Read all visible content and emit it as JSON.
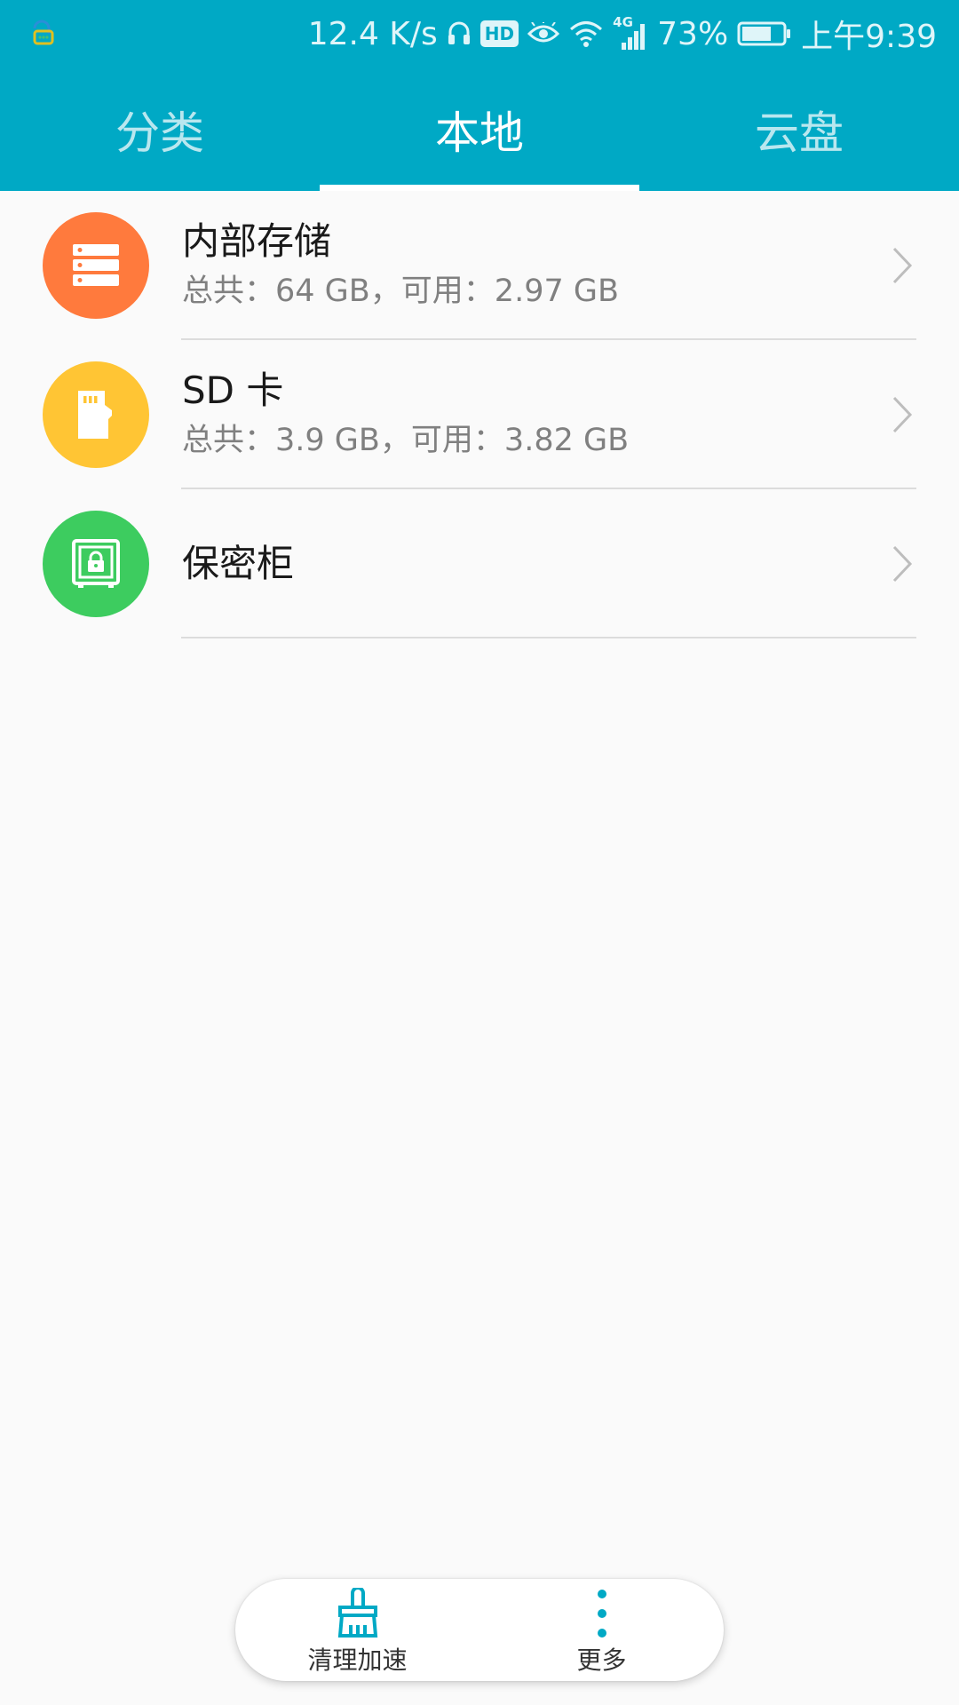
{
  "status_bar": {
    "network_speed": "12.4 K/s",
    "hd_label": "HD",
    "network_type": "4G",
    "battery_percent": "73%",
    "battery_level": 0.73,
    "time": "上午9:39",
    "icons": [
      "notification-chat-icon",
      "headphones-icon",
      "hd-icon",
      "eye-icon",
      "wifi-icon",
      "signal-icon",
      "battery-icon"
    ]
  },
  "tabs": [
    {
      "label": "分类",
      "active": false
    },
    {
      "label": "本地",
      "active": true
    },
    {
      "label": "云盘",
      "active": false
    }
  ],
  "storage_items": [
    {
      "title": "内部存储",
      "subtitle": "总共：64 GB，可用：2.97 GB",
      "icon": "server-icon",
      "color": "#ff7a3d"
    },
    {
      "title": "SD 卡",
      "subtitle": "总共：3.9 GB，可用：3.82 GB",
      "icon": "sd-card-icon",
      "color": "#ffc534"
    },
    {
      "title": "保密柜",
      "subtitle": "",
      "icon": "safe-lock-icon",
      "color": "#3dcc5f"
    }
  ],
  "bottom_bar": {
    "clean_label": "清理加速",
    "more_label": "更多",
    "accent_color": "#00a9c5"
  },
  "colors": {
    "header": "#00a9c5",
    "background": "#fafafa"
  }
}
